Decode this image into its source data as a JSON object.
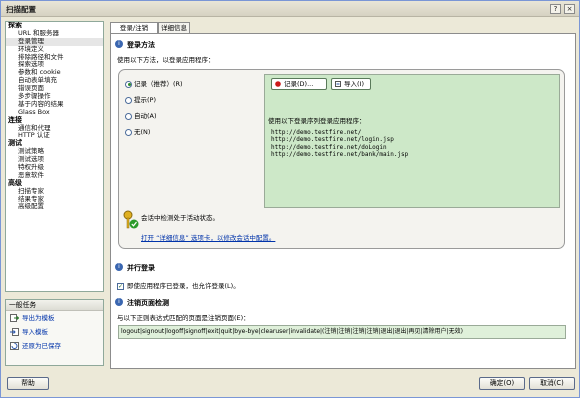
{
  "window": {
    "title": "扫描配置"
  },
  "title_buttons": {
    "help": "?",
    "close": "×"
  },
  "tree": [
    {
      "group": "探索",
      "items": [
        "URL 和服务器",
        "登录管理",
        "环境定义",
        "排除路径和文件",
        "探索选项",
        "参数和 cookie",
        "自动表单填充",
        "错误页面",
        "多步骤操作",
        "基于内容的结果",
        "Glass Box"
      ]
    },
    {
      "group": "连接",
      "items": [
        "通信和代理",
        "HTTP 认证"
      ]
    },
    {
      "group": "测试",
      "items": [
        "测试策略",
        "测试选项",
        "特权升级",
        "恶意软件"
      ]
    },
    {
      "group": "高级",
      "items": [
        "扫描专家",
        "结果专家",
        "高级配置"
      ]
    }
  ],
  "tasks": {
    "header": "一般任务",
    "items": [
      "导出为模板",
      "导入模板",
      "还原为已保存"
    ]
  },
  "tabs": [
    "登录/注销",
    "详细信息"
  ],
  "login_method": {
    "title": "登录方法",
    "desc": "使用以下方法，以登录应用程序：",
    "options": [
      "记录（推荐）(R)",
      "提示(P)",
      "自动(A)",
      "无(N)"
    ],
    "selected": 0,
    "record_button": "记录(D)...",
    "import_button": "导入(I)",
    "sequence_label": "使用以下登录序列登录应用程序：",
    "urls": [
      "http://demo.testfire.net/",
      "http://demo.testfire.net/login.jsp",
      "http://demo.testfire.net/doLogin",
      "http://demo.testfire.net/bank/main.jsp"
    ],
    "state_text": "会话中检测处于活动状态。",
    "details_link": "打开 “详细信息” 选项卡，以修改会话中配置。"
  },
  "concurrent": {
    "title": "并行登录",
    "checkbox_label": "即使应用程序已登录，也允许登录(L)。",
    "checked": true
  },
  "logout": {
    "title": "注销页面检测",
    "desc": "与以下正则表达式匹配的页面是注销页面(E)：",
    "regex": "logout|signout|logoff|signoff|exit|quit|bye-bye|clearuser|invalidate|(注销|注销|注销|注销|退出|退出|再见|清除用户|无效)"
  },
  "footer": {
    "help": "帮助",
    "ok": "确定(O)",
    "cancel": "取消(C)"
  },
  "colors": {
    "tree_bg": "#ffffff",
    "panel_green": "#cde8c8",
    "accent_blue": "#3a66b0",
    "link": "#0033aa"
  }
}
